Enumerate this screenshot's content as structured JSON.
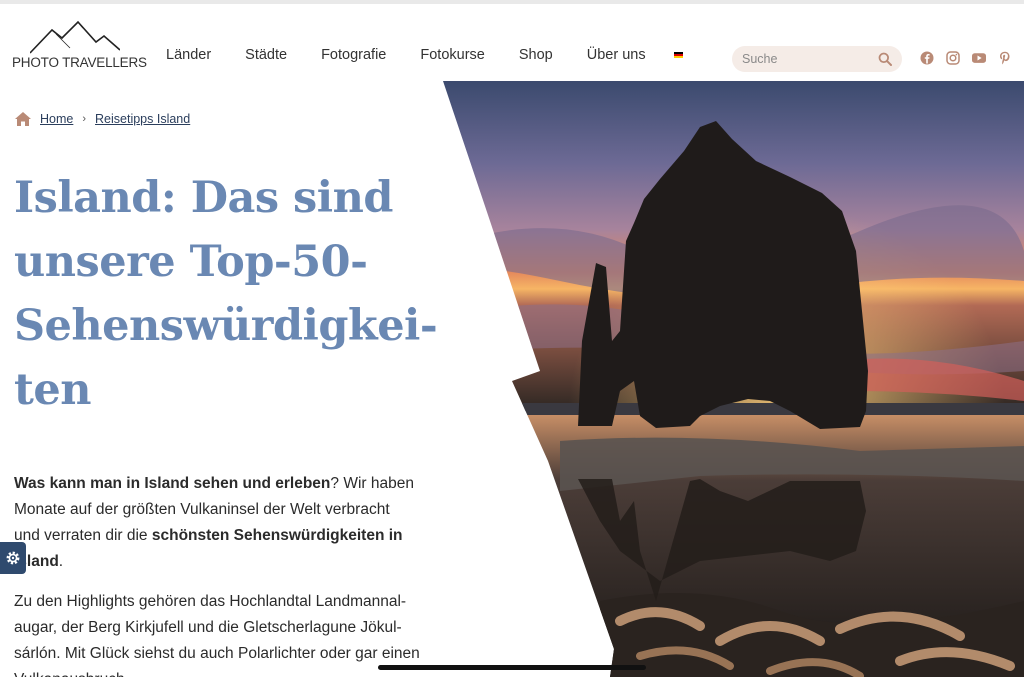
{
  "brand": {
    "logo_text": "PHOTO TRAVELLERS"
  },
  "nav": {
    "items": [
      {
        "label": "Länder"
      },
      {
        "label": "Städte"
      },
      {
        "label": "Fotografie"
      },
      {
        "label": "Fotokurse"
      },
      {
        "label": "Shop"
      },
      {
        "label": "Über uns"
      }
    ],
    "language_flag": "german-flag-icon"
  },
  "search": {
    "placeholder": "Suche"
  },
  "socials": [
    "facebook-icon",
    "instagram-icon",
    "youtube-icon",
    "pinterest-icon"
  ],
  "breadcrumb": {
    "home": "Home",
    "separator": "›",
    "current": "Reisetipps Island"
  },
  "article": {
    "title_lines": [
      "Island: Das sind",
      "unsere Top-50-",
      "Sehenswürdigkei-",
      "ten"
    ],
    "intro": {
      "p1_bold_1": "Was kann man in Island sehen und erleben",
      "p1_text_1": "? Wir haben",
      "p1_line_2": "Monate auf der größten Vulkaninsel der Welt verbracht",
      "p1_text_3": "und verraten dir die ",
      "p1_bold_3": "schönsten Sehenswürdigkeiten in",
      "p1_bold_4": "Island",
      "p1_text_4": ".",
      "p2_lines": [
        "Zu den Highlights gehören das Hochlandtal Landmannal-",
        "augar, der Berg Kirkjufell und die Gletscherlagune Jökul-",
        "sárlón. Mit Glück siehst du auch Polarlichter oder gar einen",
        "Vulkanausbruch."
      ]
    }
  },
  "colors": {
    "title": "#6a88b3",
    "link": "#2b3e5c",
    "search_bg": "#f5ece7",
    "settings_bg": "#2f4a6e",
    "icon_accent": "#b98a76"
  }
}
